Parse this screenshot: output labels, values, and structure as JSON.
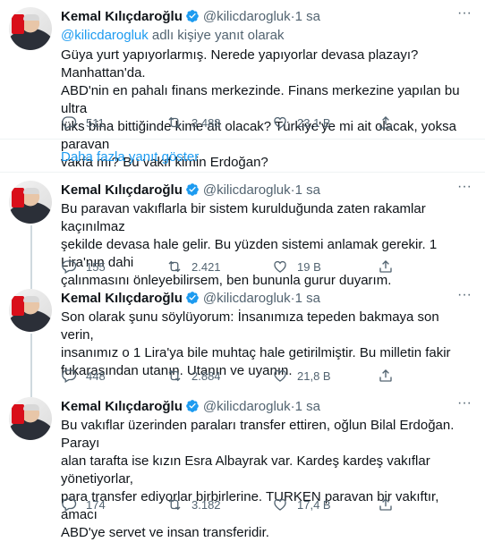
{
  "tweets": [
    {
      "name": "Kemal Kılıçdaroğlu",
      "handle": "@kilicdarogluk",
      "time": "1 sa",
      "reply_prefix": "@kilicdarogluk",
      "reply_suffix": " adlı kişiye yanıt olarak",
      "text": "Güya yurt yapıyorlarmış. Nerede yapıyorlar devasa plazayı? Manhattan'da.\nABD'nin en pahalı finans merkezinde. Finans merkezine yapılan bu ultra\nlüks bina bittiğinde kime ait olacak? Türkiye'ye mi ait olacak, yoksa paravan\nvakfa mı? Bu vakıf kimin Erdoğan?",
      "replies": "511",
      "retweets": "3.488",
      "likes": "23,1 B"
    },
    {
      "name": "Kemal Kılıçdaroğlu",
      "handle": "@kilicdarogluk",
      "time": "1 sa",
      "text": "Bu paravan vakıflarla bir sistem kurulduğunda zaten rakamlar kaçınılmaz\nşekilde devasa hale gelir. Bu yüzden sistemi anlamak gerekir. 1 Lira'nın dahi\nçalınmasını önleyebilirsem, ben bununla gurur duyarım.",
      "replies": "155",
      "retweets": "2.421",
      "likes": "19 B"
    },
    {
      "name": "Kemal Kılıçdaroğlu",
      "handle": "@kilicdarogluk",
      "time": "1 sa",
      "text": "Son olarak şunu söylüyorum: İnsanımıza tepeden bakmaya son verin,\ninsanımız o 1 Lira'ya bile muhtaç hale getirilmiştir. Bu milletin fakir\nfukarasından utanın. Utanın ve uyanın.",
      "replies": "448",
      "retweets": "2.884",
      "likes": "21,8 B"
    },
    {
      "name": "Kemal Kılıçdaroğlu",
      "handle": "@kilicdarogluk",
      "time": "1 sa",
      "text": "Bu vakıflar üzerinden paraları transfer ettiren, oğlun Bilal Erdoğan. Parayı\nalan tarafta ise kızın Esra Albayrak var. Kardeş kardeş vakıflar yönetiyorlar,\npara transfer ediyorlar birbirlerine. TURKEN paravan bir vakıftır, amacı\nABD'ye servet ve insan transferidir.",
      "replies": "174",
      "retweets": "3.182",
      "likes": "17,4 B"
    }
  ],
  "show_more_replies": "Daha fazla yanıt göster",
  "separator": " · ",
  "more_icon": "more-horizontal-icon",
  "colors": {
    "accent": "#1d9bf0",
    "muted": "#536471",
    "text": "#0f1419",
    "border": "#eff3f4"
  }
}
